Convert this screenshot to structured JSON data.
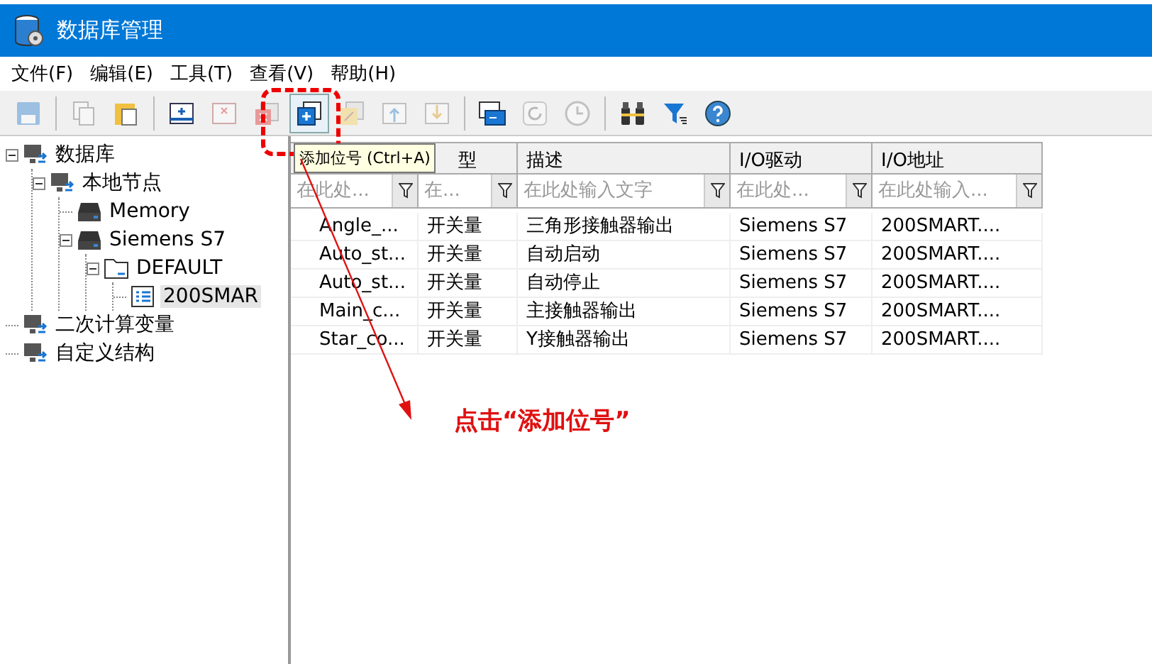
{
  "window": {
    "title": "数据库管理"
  },
  "menu": [
    "文件(F)",
    "编辑(E)",
    "工具(T)",
    "查看(V)",
    "帮助(H)"
  ],
  "toolbar": [
    {
      "kind": "save",
      "disabled": true,
      "pressed": false
    },
    {
      "kind": "sep"
    },
    {
      "kind": "copy",
      "disabled": true,
      "pressed": false
    },
    {
      "kind": "paste",
      "disabled": false,
      "pressed": false
    },
    {
      "kind": "sep"
    },
    {
      "kind": "add-table",
      "disabled": false,
      "pressed": false
    },
    {
      "kind": "remove-table",
      "disabled": true,
      "pressed": false
    },
    {
      "kind": "delete",
      "disabled": true,
      "pressed": false
    },
    {
      "kind": "add-tag",
      "disabled": false,
      "pressed": true
    },
    {
      "kind": "edit",
      "disabled": true,
      "pressed": false
    },
    {
      "kind": "move-up",
      "disabled": true,
      "pressed": false
    },
    {
      "kind": "move-down",
      "disabled": true,
      "pressed": false
    },
    {
      "kind": "sep"
    },
    {
      "kind": "window",
      "disabled": false,
      "pressed": false
    },
    {
      "kind": "refresh",
      "disabled": true,
      "pressed": false
    },
    {
      "kind": "history",
      "disabled": true,
      "pressed": false
    },
    {
      "kind": "sep"
    },
    {
      "kind": "find",
      "disabled": false,
      "pressed": false
    },
    {
      "kind": "filter",
      "disabled": false,
      "pressed": false
    },
    {
      "kind": "help",
      "disabled": false,
      "pressed": false
    }
  ],
  "tree": [
    {
      "label": "数据库",
      "kind": "db",
      "expanded": true,
      "selected": false,
      "children": [
        {
          "label": "本地节点",
          "kind": "db",
          "expanded": true,
          "selected": false,
          "children": [
            {
              "label": "Memory",
              "kind": "drive",
              "selected": false
            },
            {
              "label": "Siemens S7",
              "kind": "drive",
              "expanded": true,
              "selected": false,
              "children": [
                {
                  "label": "DEFAULT",
                  "kind": "folder",
                  "expanded": true,
                  "selected": false,
                  "children": [
                    {
                      "label": "200SMAR",
                      "kind": "table",
                      "selected": true
                    }
                  ]
                }
              ]
            }
          ]
        }
      ]
    },
    {
      "label": "二次计算变量",
      "kind": "db",
      "selected": false
    },
    {
      "label": "自定义结构",
      "kind": "db",
      "selected": false
    }
  ],
  "table": {
    "columns": [
      {
        "placeholder": "在此处..."
      },
      {
        "header": "型",
        "placeholder": "在..."
      },
      {
        "header": "描述",
        "placeholder": "在此处输入文字"
      },
      {
        "header": "I/O驱动",
        "placeholder": "在此处..."
      },
      {
        "header": "I/O地址",
        "placeholder": "在此处输入..."
      }
    ],
    "rows": [
      [
        "Angle_...",
        "开关量",
        "三角形接触器输出",
        "Siemens S7",
        "200SMART...."
      ],
      [
        "Auto_st...",
        "开关量",
        "自动启动",
        "Siemens S7",
        "200SMART...."
      ],
      [
        "Auto_st...",
        "开关量",
        "自动停止",
        "Siemens S7",
        "200SMART...."
      ],
      [
        "Main_c...",
        "开关量",
        "主接触器输出",
        "Siemens S7",
        "200SMART...."
      ],
      [
        "Star_co...",
        "开关量",
        "Y接触器输出",
        "Siemens S7",
        "200SMART...."
      ]
    ]
  },
  "tooltip": "添加位号 (Ctrl+A)",
  "annotation": "点击“添加位号”"
}
